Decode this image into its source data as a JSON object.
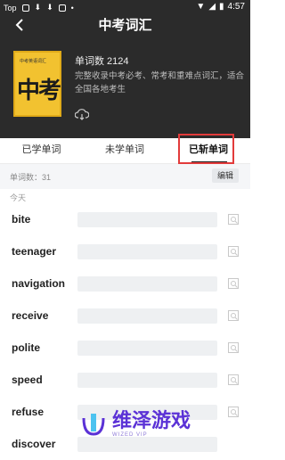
{
  "status_bar": {
    "left_label": "Top",
    "time": "4:57"
  },
  "header": {
    "title": "中考词汇",
    "book_cover": {
      "small_text": "中考英语词汇",
      "big_text": "中考"
    },
    "word_count": "单词数 2124",
    "description": "完整收录中考必考、常考和重难点词汇，适合全国各地考生"
  },
  "tabs": [
    {
      "label": "已学单词",
      "active": false
    },
    {
      "label": "未学单词",
      "active": false
    },
    {
      "label": "已斩单词",
      "active": true
    }
  ],
  "subbar": {
    "count_label": "单词数：31",
    "edit_label": "编辑"
  },
  "section_label": "今天",
  "words": [
    "bite",
    "teenager",
    "navigation",
    "receive",
    "polite",
    "speed",
    "refuse",
    "discover"
  ],
  "watermark": {
    "text": "维泽游戏",
    "sub": "WIZED VIP"
  },
  "colors": {
    "header_bg": "#2b2b2b",
    "highlight": "#e23b3b",
    "cover": "#f2c230",
    "watermark": "#5b32d6"
  }
}
